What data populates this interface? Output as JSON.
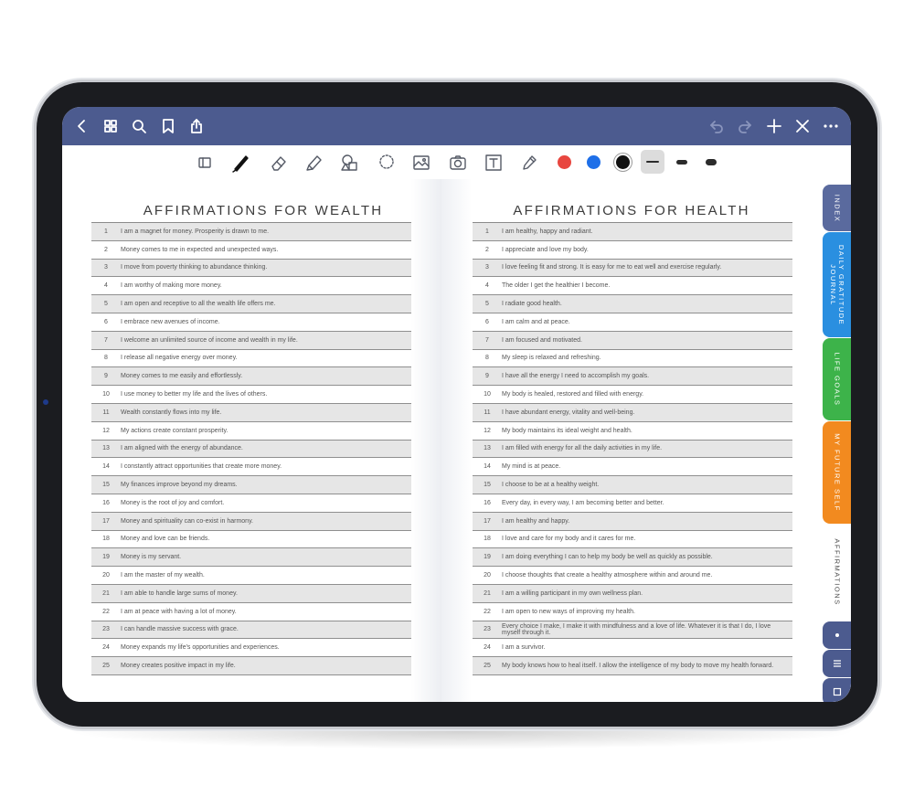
{
  "topbar": {
    "left_icons": [
      "back-icon",
      "grid-icon",
      "search-icon",
      "bookmark-icon",
      "share-icon"
    ],
    "right_icons": [
      "undo-icon",
      "redo-icon",
      "add-icon",
      "close-icon",
      "more-icon"
    ]
  },
  "toolbar": {
    "tools": [
      "layout-icon",
      "pen-icon",
      "eraser-icon",
      "highlighter-icon",
      "shapes-icon",
      "lasso-icon",
      "image-icon",
      "camera-icon",
      "text-icon",
      "eyedropper-icon"
    ],
    "colors": [
      "#e8463f",
      "#1e6fe8",
      "#111111"
    ],
    "selected_color": "#111111",
    "thicknesses": [
      "thin",
      "medium",
      "thick"
    ],
    "selected_thickness": "thin"
  },
  "left_page": {
    "title": "AFFIRMATIONS FOR WEALTH",
    "rows": [
      {
        "n": "1",
        "t": "I am a magnet for money. Prosperity is drawn to me."
      },
      {
        "n": "2",
        "t": "Money comes to me in expected and unexpected ways."
      },
      {
        "n": "3",
        "t": "I move from poverty thinking to abundance thinking."
      },
      {
        "n": "4",
        "t": "I am worthy of making more money."
      },
      {
        "n": "5",
        "t": "I am open and receptive to all the wealth life offers me."
      },
      {
        "n": "6",
        "t": "I embrace new avenues of income."
      },
      {
        "n": "7",
        "t": "I welcome an unlimited source of income and wealth in my life."
      },
      {
        "n": "8",
        "t": "I release all negative energy over money."
      },
      {
        "n": "9",
        "t": "Money comes to me easily and effortlessly."
      },
      {
        "n": "10",
        "t": "I use money to better my life and the lives of others."
      },
      {
        "n": "11",
        "t": "Wealth constantly flows into my life."
      },
      {
        "n": "12",
        "t": "My actions create constant prosperity."
      },
      {
        "n": "13",
        "t": "I am aligned with the energy of abundance."
      },
      {
        "n": "14",
        "t": "I constantly attract opportunities that create more money."
      },
      {
        "n": "15",
        "t": "My finances improve beyond my dreams."
      },
      {
        "n": "16",
        "t": "Money is the root of joy and comfort."
      },
      {
        "n": "17",
        "t": "Money and spirituality can co-exist in harmony."
      },
      {
        "n": "18",
        "t": "Money and love can be friends."
      },
      {
        "n": "19",
        "t": "Money is my servant."
      },
      {
        "n": "20",
        "t": "I am the master of my wealth."
      },
      {
        "n": "21",
        "t": "I am able to handle large sums of money."
      },
      {
        "n": "22",
        "t": "I am at peace with having a lot of money."
      },
      {
        "n": "23",
        "t": "I can handle massive success with grace."
      },
      {
        "n": "24",
        "t": "Money expands my life's opportunities and experiences."
      },
      {
        "n": "25",
        "t": "Money creates positive impact in my life."
      }
    ]
  },
  "right_page": {
    "title": "AFFIRMATIONS FOR HEALTH",
    "rows": [
      {
        "n": "1",
        "t": "I am healthy, happy and radiant."
      },
      {
        "n": "2",
        "t": "I appreciate and love my body."
      },
      {
        "n": "3",
        "t": "I love feeling fit and strong. It is easy for me to eat well and exercise regularly."
      },
      {
        "n": "4",
        "t": "The older I get the healthier I become."
      },
      {
        "n": "5",
        "t": "I radiate good health."
      },
      {
        "n": "6",
        "t": "I am calm and at peace."
      },
      {
        "n": "7",
        "t": "I am focused and motivated."
      },
      {
        "n": "8",
        "t": "My sleep is relaxed and refreshing."
      },
      {
        "n": "9",
        "t": "I have all the energy I need to accomplish my goals."
      },
      {
        "n": "10",
        "t": "My body is healed, restored and filled with energy."
      },
      {
        "n": "11",
        "t": "I have abundant energy, vitality and well-being."
      },
      {
        "n": "12",
        "t": "My body maintains its ideal weight and health."
      },
      {
        "n": "13",
        "t": "I am filled with energy for all the daily activities in my life."
      },
      {
        "n": "14",
        "t": "My mind is at peace."
      },
      {
        "n": "15",
        "t": "I choose to be at a healthy weight."
      },
      {
        "n": "16",
        "t": "Every day, in every way, I am becoming better and better."
      },
      {
        "n": "17",
        "t": "I am healthy and happy."
      },
      {
        "n": "18",
        "t": "I love and care for my body and it cares for me."
      },
      {
        "n": "19",
        "t": "I am doing everything I can to help my body be well as quickly as possible."
      },
      {
        "n": "20",
        "t": "I choose thoughts that create a healthy atmosphere within and around me."
      },
      {
        "n": "21",
        "t": "I am a willing participant in my own wellness plan."
      },
      {
        "n": "22",
        "t": "I am open to new ways of improving my health."
      },
      {
        "n": "23",
        "t": "Every choice I make, I make it with mindfulness and a love of life. Whatever it is that I do, I love myself through it."
      },
      {
        "n": "24",
        "t": "I am a survivor."
      },
      {
        "n": "25",
        "t": "My body knows how to heal itself. I allow the intelligence of my body to move my health forward."
      }
    ]
  },
  "side_tabs": [
    {
      "label": "INDEX",
      "color": "#5a6a9e"
    },
    {
      "label": "DAILY GRATITUDE JOURNAL",
      "color": "#2a8fe0"
    },
    {
      "label": "LIFE GOALS",
      "color": "#3db34a"
    },
    {
      "label": "MY FUTURE SELF",
      "color": "#f28a1f"
    },
    {
      "label": "AFFIRMATIONS",
      "color": "#ffffff"
    }
  ],
  "mini_buttons": [
    "dot-icon",
    "menu-icon",
    "square-icon"
  ]
}
